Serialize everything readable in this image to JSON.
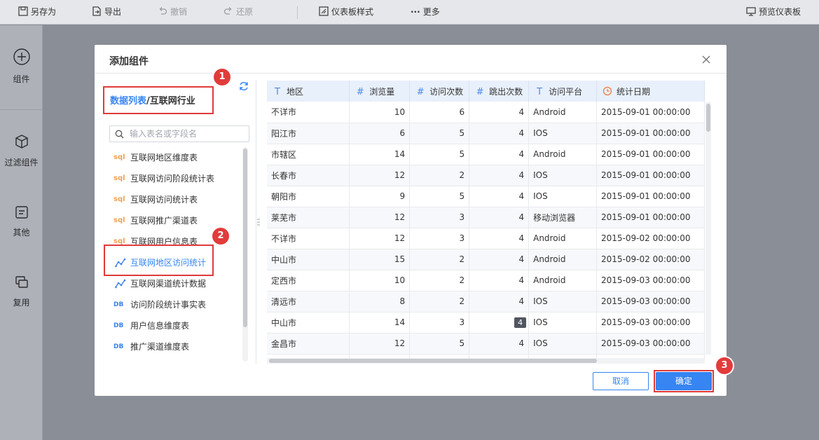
{
  "toolbar": {
    "save_as": "另存为",
    "export": "导出",
    "undo": "撤销",
    "redo": "还原",
    "dashboard_style": "仪表板样式",
    "more": "更多",
    "preview": "预览仪表板"
  },
  "leftbar": {
    "components": "组件",
    "filter_components": "过滤组件",
    "other": "其他",
    "reuse": "复用"
  },
  "dialog": {
    "title": "添加组件",
    "breadcrumb_link": "数据列表",
    "breadcrumb_sep": "/",
    "breadcrumb_current": "互联网行业",
    "search_placeholder": "输入表名或字段名",
    "tables": [
      {
        "icon": "sql",
        "label": "互联网地区维度表"
      },
      {
        "icon": "sql",
        "label": "互联网访问阶段统计表"
      },
      {
        "icon": "sql",
        "label": "互联网访问统计表"
      },
      {
        "icon": "sql",
        "label": "互联网推广渠道表"
      },
      {
        "icon": "sql",
        "label": "互联网用户信息表"
      },
      {
        "icon": "analysis",
        "label": "互联网地区访问统计"
      },
      {
        "icon": "analysis",
        "label": "互联网渠道统计数据"
      },
      {
        "icon": "db",
        "label": "访问阶段统计事实表"
      },
      {
        "icon": "db",
        "label": "用户信息维度表"
      },
      {
        "icon": "db",
        "label": "推广渠道维度表"
      }
    ],
    "badges": [
      "1",
      "2",
      "3"
    ],
    "columns": [
      {
        "type": "T",
        "name": "地区"
      },
      {
        "type": "#",
        "name": "浏览量"
      },
      {
        "type": "#",
        "name": "访问次数"
      },
      {
        "type": "#",
        "name": "跳出次数"
      },
      {
        "type": "T",
        "name": "访问平台"
      },
      {
        "type": "date",
        "name": "统计日期"
      }
    ],
    "rows": [
      [
        "不详市",
        "10",
        "6",
        "4",
        "Android",
        "2015-09-01 00:00:00"
      ],
      [
        "阳江市",
        "6",
        "5",
        "4",
        "IOS",
        "2015-09-01 00:00:00"
      ],
      [
        "市辖区",
        "14",
        "5",
        "4",
        "Android",
        "2015-09-01 00:00:00"
      ],
      [
        "长春市",
        "12",
        "2",
        "4",
        "IOS",
        "2015-09-01 00:00:00"
      ],
      [
        "朝阳市",
        "9",
        "5",
        "4",
        "IOS",
        "2015-09-01 00:00:00"
      ],
      [
        "莱芜市",
        "12",
        "3",
        "4",
        "移动浏览器",
        "2015-09-01 00:00:00"
      ],
      [
        "不详市",
        "12",
        "3",
        "4",
        "Android",
        "2015-09-02 00:00:00"
      ],
      [
        "中山市",
        "15",
        "2",
        "4",
        "Android",
        "2015-09-02 00:00:00"
      ],
      [
        "定西市",
        "10",
        "2",
        "4",
        "Android",
        "2015-09-03 00:00:00"
      ],
      [
        "清远市",
        "8",
        "2",
        "4",
        "IOS",
        "2015-09-03 00:00:00"
      ],
      [
        "中山市",
        "14",
        "3",
        "4",
        "IOS",
        "2015-09-03 00:00:00"
      ],
      [
        "金昌市",
        "12",
        "5",
        "4",
        "IOS",
        "2015-09-03 00:00:00"
      ],
      [
        "",
        "",
        "",
        "",
        "",
        ""
      ]
    ],
    "cancel": "取消",
    "confirm": "确定"
  },
  "colors": {
    "accent": "#3685f2",
    "highlight_red": "#e03a3a",
    "header_bg": "#e8f0fb"
  }
}
